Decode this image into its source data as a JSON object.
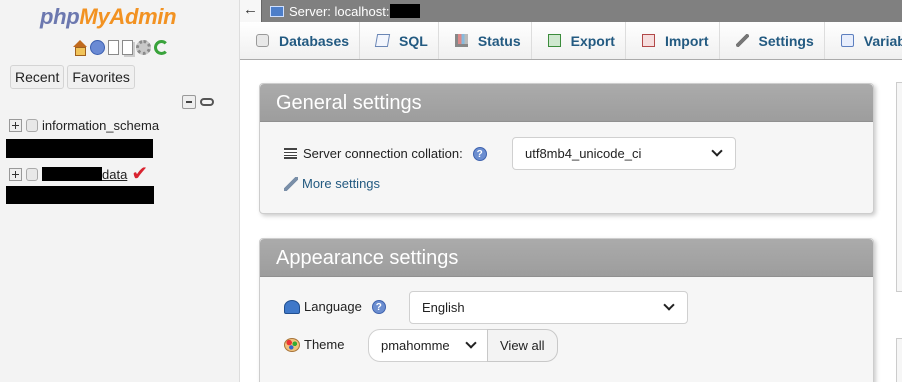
{
  "nav": {
    "logo_php": "php",
    "logo_myadmin": "MyAdmin",
    "quick_icons": [
      "home-icon",
      "exit-icon",
      "docs-icon",
      "sql-docs-icon",
      "settings-icon",
      "reload-icon"
    ],
    "tabs": [
      {
        "label": "Recent"
      },
      {
        "label": "Favorites"
      }
    ],
    "databases": [
      {
        "name": "information_schema"
      },
      {
        "name": "data"
      }
    ]
  },
  "topbar": {
    "server_label": "Server: localhost:"
  },
  "menu": {
    "tabs": [
      {
        "label": "Databases",
        "icon": "database-icon"
      },
      {
        "label": "SQL",
        "icon": "sql-icon"
      },
      {
        "label": "Status",
        "icon": "status-icon"
      },
      {
        "label": "Export",
        "icon": "export-icon"
      },
      {
        "label": "Import",
        "icon": "import-icon"
      },
      {
        "label": "Settings",
        "icon": "wrench-icon"
      },
      {
        "label": "Variables",
        "icon": "variables-icon"
      }
    ]
  },
  "general": {
    "title": "General settings",
    "collation_label": "Server connection collation:",
    "collation_value": "utf8mb4_unicode_ci",
    "more_settings": "More settings"
  },
  "appearance": {
    "title": "Appearance settings",
    "language_label": "Language",
    "language_value": "English",
    "theme_label": "Theme",
    "theme_value": "pmahomme",
    "view_all": "View all"
  },
  "help_glyph": "?"
}
